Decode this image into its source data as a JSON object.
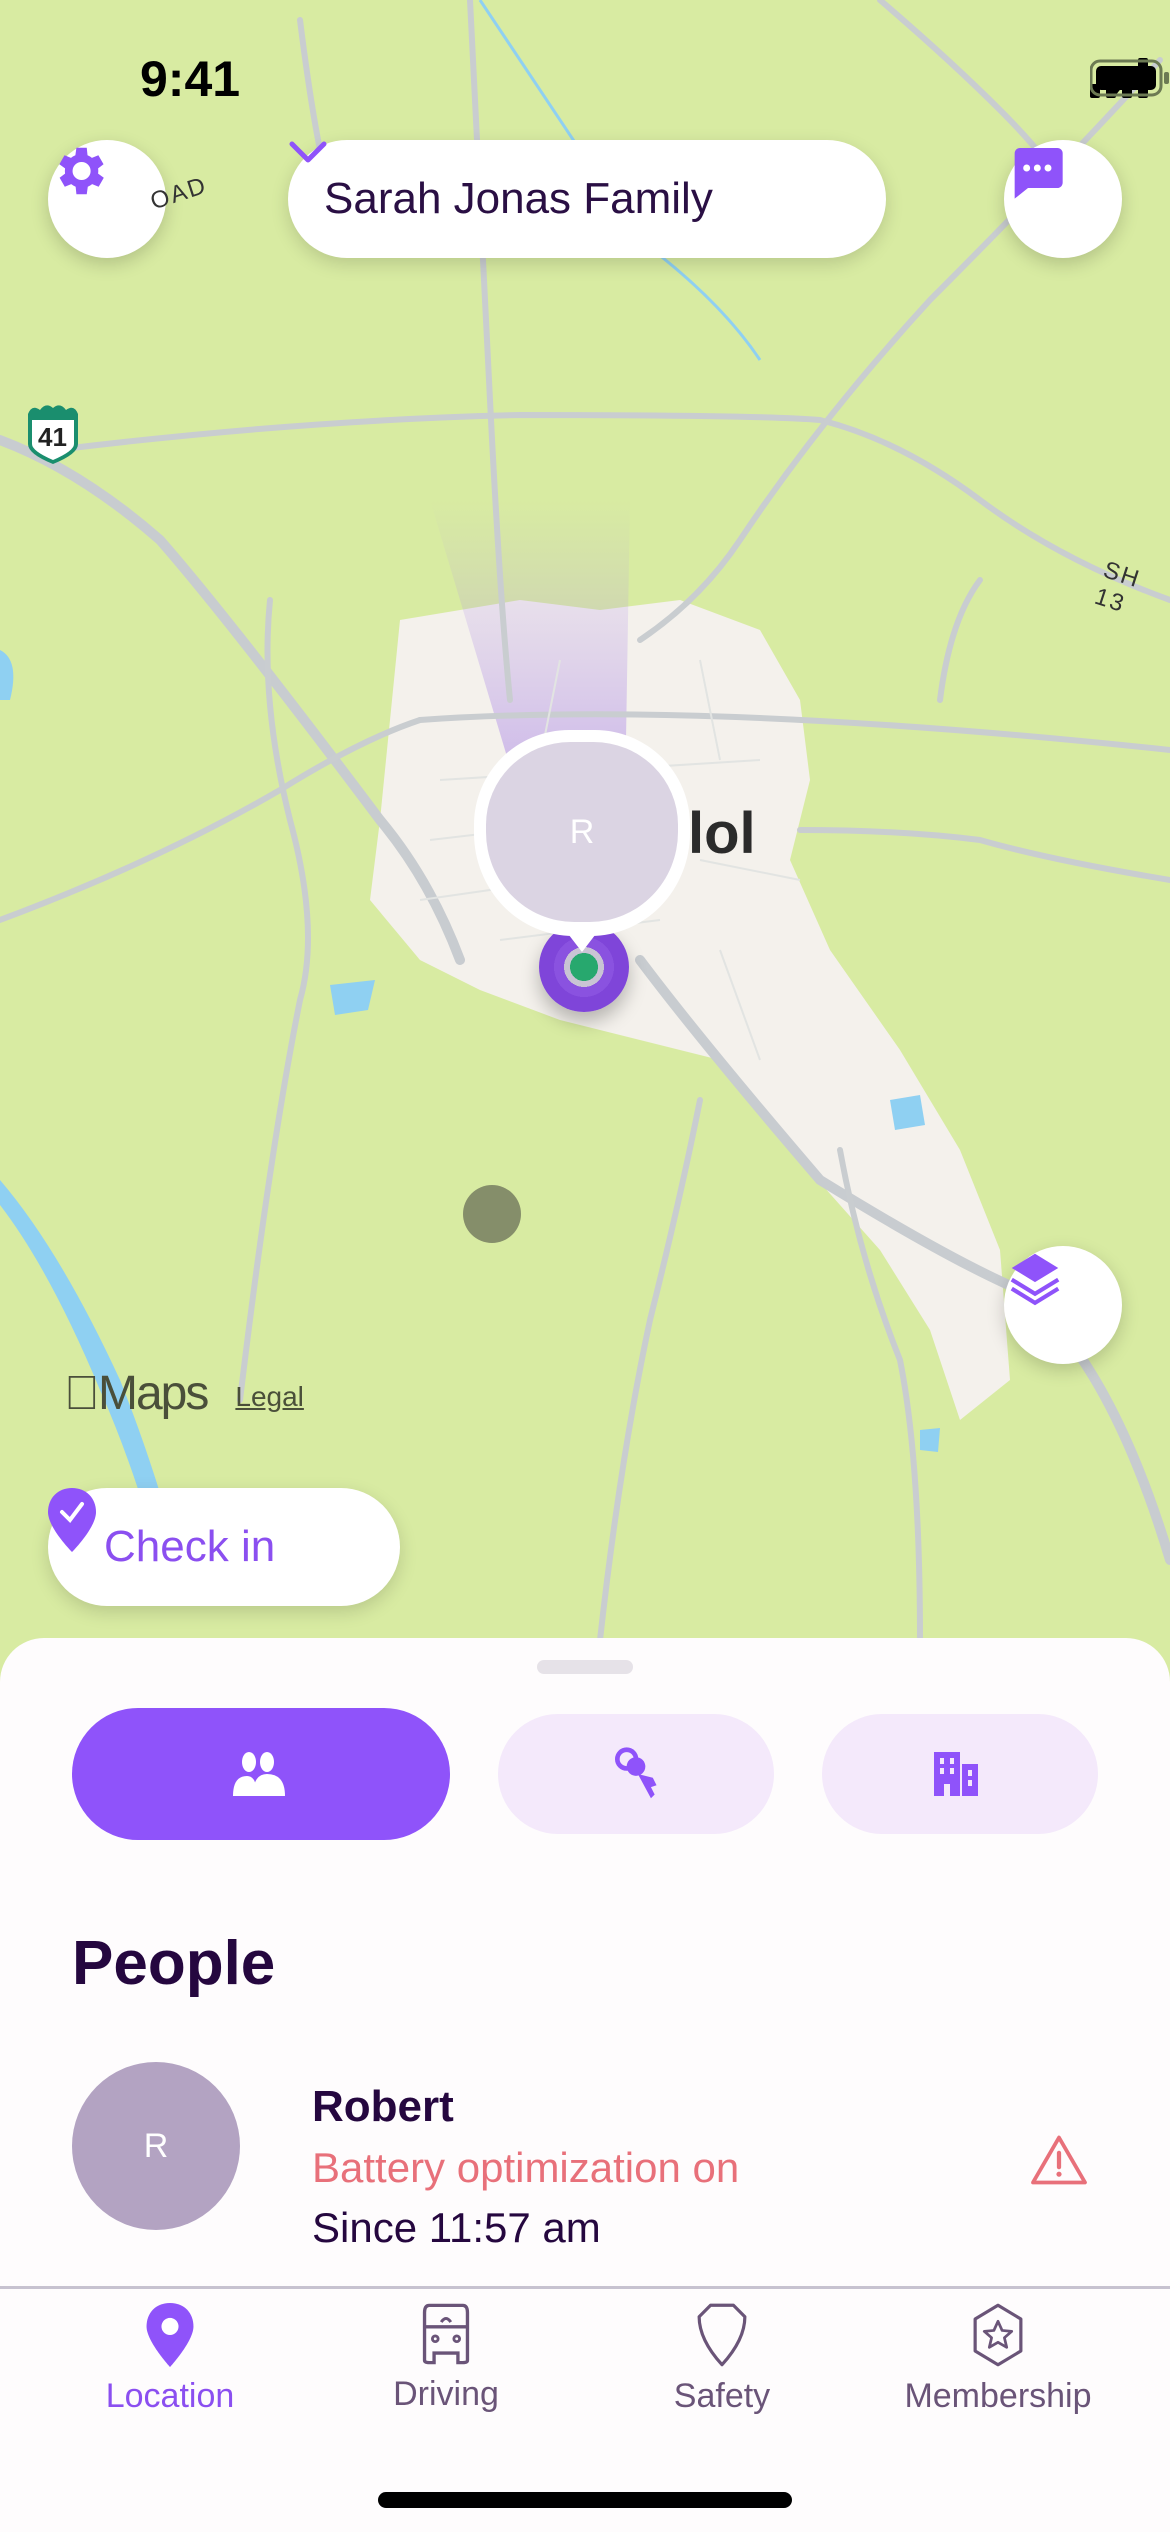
{
  "status_bar": {
    "time": "9:41"
  },
  "header": {
    "settings_icon": "gear-icon",
    "circle_name": "Sarah Jonas Family",
    "circle_dropdown_icon": "chevron-down-icon",
    "messages_icon": "chat-bubble-icon"
  },
  "map": {
    "place_label": "lol",
    "highway_shield": "41",
    "road_label_sh": "SH 13",
    "road_label_road": "OAD",
    "member_pin_initial": "R",
    "attribution_brand": "Maps",
    "attribution_legal": "Legal",
    "layers_icon": "layers-icon",
    "checkin_label": "Check in"
  },
  "sheet": {
    "segments": [
      {
        "id": "people",
        "icon": "people-icon",
        "active": true
      },
      {
        "id": "items",
        "icon": "keys-icon",
        "active": false
      },
      {
        "id": "places",
        "icon": "building-icon",
        "active": false
      }
    ],
    "section_title": "People",
    "people": [
      {
        "initial": "R",
        "name": "Robert",
        "status": "Battery optimization on",
        "since": "Since 11:57 am",
        "alert_icon": "warning-icon"
      }
    ]
  },
  "tabbar": {
    "tabs": [
      {
        "label": "Location",
        "icon": "location-pin-icon",
        "active": true
      },
      {
        "label": "Driving",
        "icon": "car-icon",
        "active": false
      },
      {
        "label": "Safety",
        "icon": "shield-icon",
        "active": false
      },
      {
        "label": "Membership",
        "icon": "star-badge-icon",
        "active": false
      }
    ]
  },
  "colors": {
    "brand": "#8f53fa",
    "brand_light": "#f4e9fb",
    "text_dark": "#25073f",
    "alert": "#e8707a",
    "map_land": "#d8eba2"
  }
}
